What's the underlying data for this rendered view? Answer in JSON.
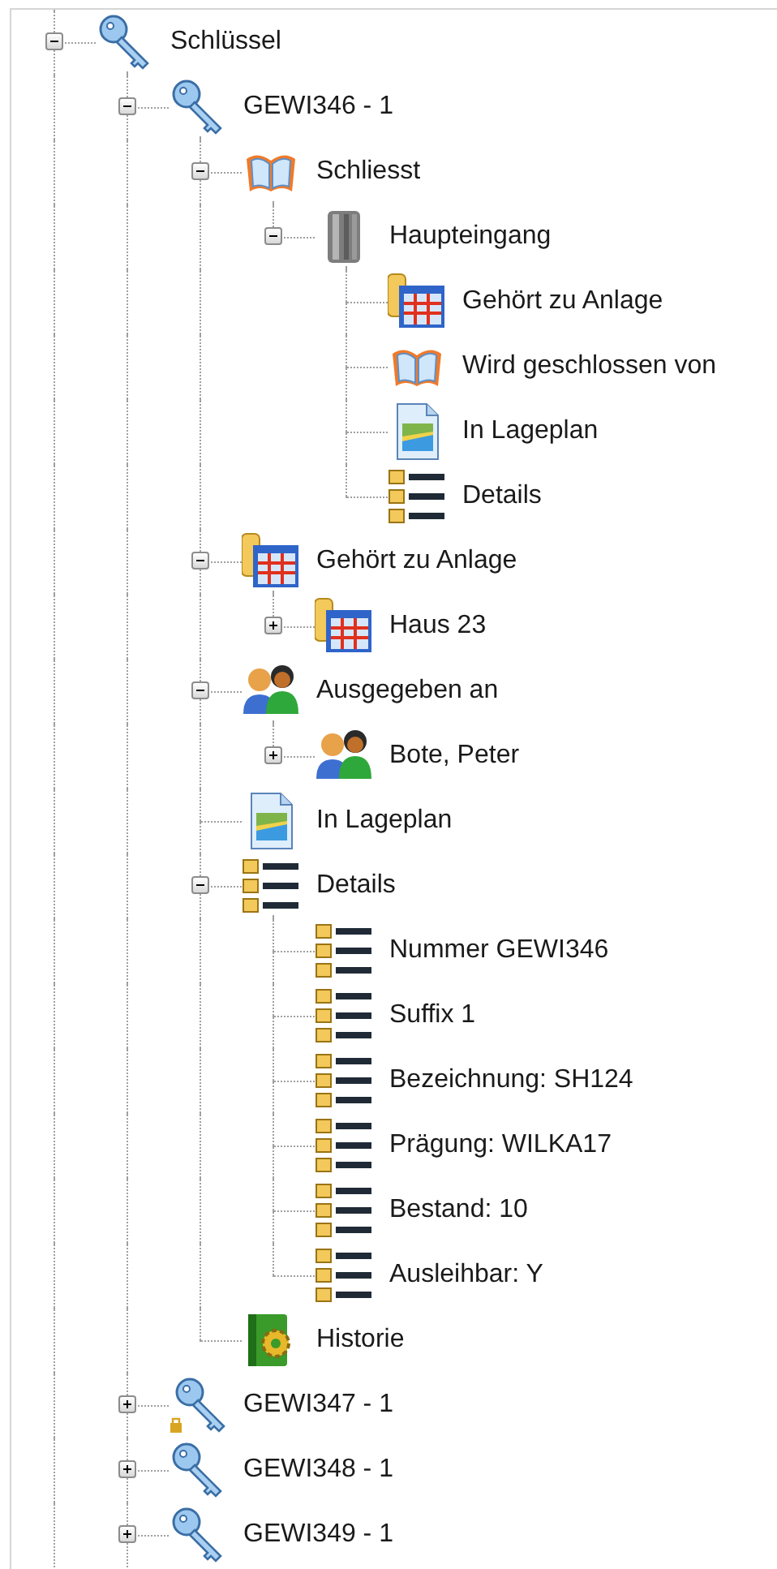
{
  "tree": [
    {
      "label": "Schlüssel",
      "kind": "key",
      "expanded": true,
      "children": [
        {
          "label": "GEWI346 - 1",
          "kind": "key",
          "badge": false,
          "expanded": true,
          "children": [
            {
              "label": "Schliesst",
              "kind": "book",
              "expanded": true,
              "children": [
                {
                  "label": "Haupteingang",
                  "kind": "server",
                  "expanded": true,
                  "children": [
                    {
                      "label": "Gehört zu Anlage",
                      "kind": "table"
                    },
                    {
                      "label": "Wird geschlossen von",
                      "kind": "book"
                    },
                    {
                      "label": "In Lageplan",
                      "kind": "image"
                    },
                    {
                      "label": "Details",
                      "kind": "details"
                    }
                  ]
                }
              ]
            },
            {
              "label": "Gehört zu Anlage",
              "kind": "table",
              "expanded": true,
              "children": [
                {
                  "label": "Haus 23",
                  "kind": "table",
                  "expanded": false
                }
              ]
            },
            {
              "label": "Ausgegeben an",
              "kind": "people",
              "expanded": true,
              "children": [
                {
                  "label": "Bote, Peter",
                  "kind": "people",
                  "expanded": false
                }
              ]
            },
            {
              "label": "In Lageplan",
              "kind": "image"
            },
            {
              "label": "Details",
              "kind": "details",
              "expanded": true,
              "children": [
                {
                  "label": "Nummer GEWI346",
                  "kind": "details"
                },
                {
                  "label": "Suffix 1",
                  "kind": "details"
                },
                {
                  "label": "Bezeichnung: SH124",
                  "kind": "details"
                },
                {
                  "label": "Prägung: WILKA17",
                  "kind": "details"
                },
                {
                  "label": "Bestand: 10",
                  "kind": "details"
                },
                {
                  "label": "Ausleihbar: Y",
                  "kind": "details"
                }
              ]
            },
            {
              "label": "Historie",
              "kind": "history"
            }
          ]
        },
        {
          "label": "GEWI347 - 1",
          "kind": "key",
          "badge": true,
          "expanded": false
        },
        {
          "label": "GEWI348 - 1",
          "kind": "key",
          "badge": false,
          "expanded": false
        },
        {
          "label": "GEWI349 - 1",
          "kind": "key",
          "badge": false,
          "expanded": false
        }
      ]
    }
  ]
}
